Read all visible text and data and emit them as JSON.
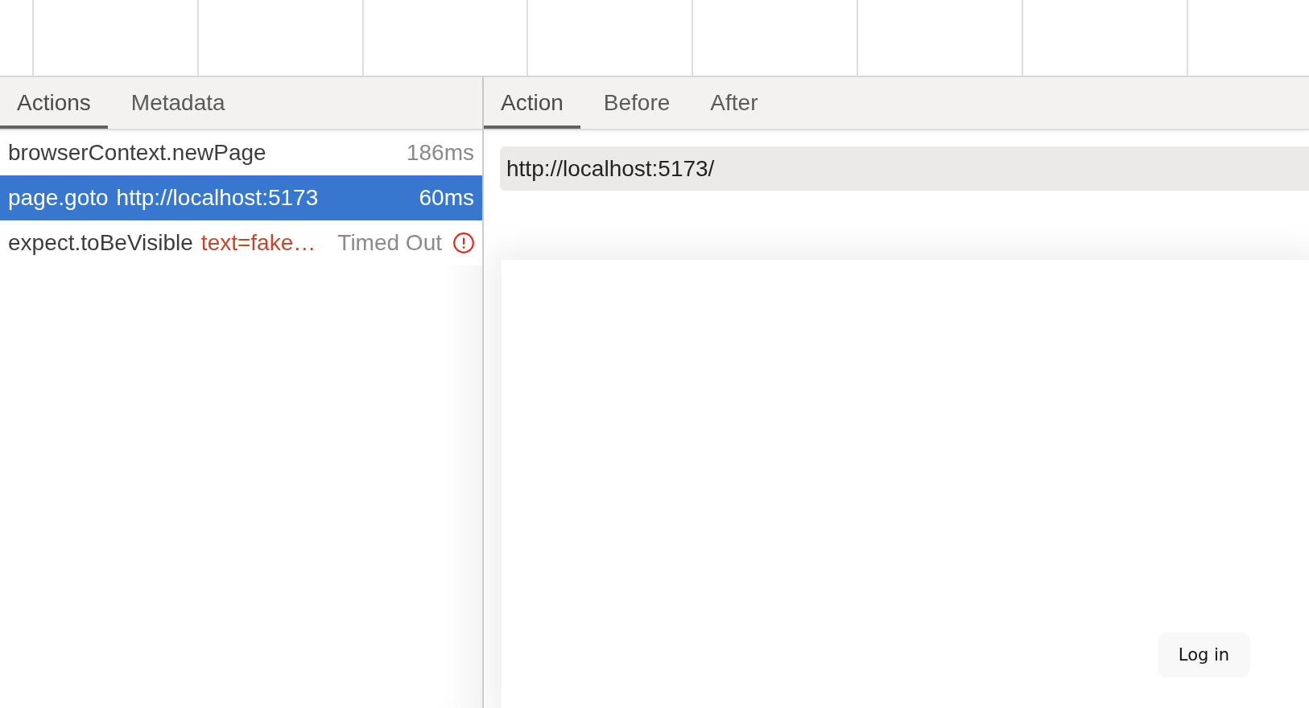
{
  "left_panel": {
    "tabs": [
      {
        "label": "Actions",
        "selected": true
      },
      {
        "label": "Metadata",
        "selected": false
      }
    ],
    "actions": [
      {
        "name": "browserContext.newPage",
        "duration": "186ms",
        "error": false,
        "selected": false
      },
      {
        "name": "page.goto",
        "param": {
          "kind": "url",
          "text": "http://localhost:5173"
        },
        "duration": "60ms",
        "error": false,
        "selected": true
      },
      {
        "name": "expect.toBeVisible",
        "param": {
          "kind": "selector",
          "text": "text=fake…"
        },
        "status": "Timed Out",
        "error": true,
        "selected": false
      }
    ]
  },
  "right_panel": {
    "tabs": [
      {
        "label": "Action",
        "selected": true
      },
      {
        "label": "Before",
        "selected": false
      },
      {
        "label": "After",
        "selected": false
      }
    ],
    "url": "http://localhost:5173/",
    "snapshot": {
      "buttons": [
        "Log in"
      ]
    }
  }
}
